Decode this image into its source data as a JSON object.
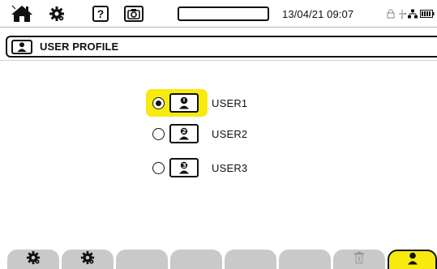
{
  "statusbar": {
    "datetime": "13/04/21 09:07",
    "progress_fraction": 0.0,
    "icons": [
      "home-icon",
      "settings-gear-icon",
      "help-icon",
      "camera-icon",
      "lock-icon",
      "usb-icon",
      "network-icon",
      "battery-icon"
    ]
  },
  "header": {
    "title": "USER PROFILE",
    "icon": "user-profile-icon"
  },
  "users": [
    {
      "label": "USER1",
      "selected": true
    },
    {
      "label": "USER2",
      "selected": false
    },
    {
      "label": "USER3",
      "selected": false
    }
  ],
  "function_keys": [
    {
      "icon": "settings-gear-icon",
      "state": "enabled"
    },
    {
      "icon": "settings-gear-icon",
      "state": "enabled"
    },
    {
      "icon": "",
      "state": "empty"
    },
    {
      "icon": "",
      "state": "empty"
    },
    {
      "icon": "",
      "state": "empty"
    },
    {
      "icon": "",
      "state": "empty"
    },
    {
      "icon": "trash-icon",
      "state": "disabled"
    },
    {
      "icon": "user-profile-icon",
      "state": "active"
    }
  ],
  "colors": {
    "highlight": "#f7ea0e",
    "key_background": "#c9c9c9",
    "foreground": "#111111"
  }
}
